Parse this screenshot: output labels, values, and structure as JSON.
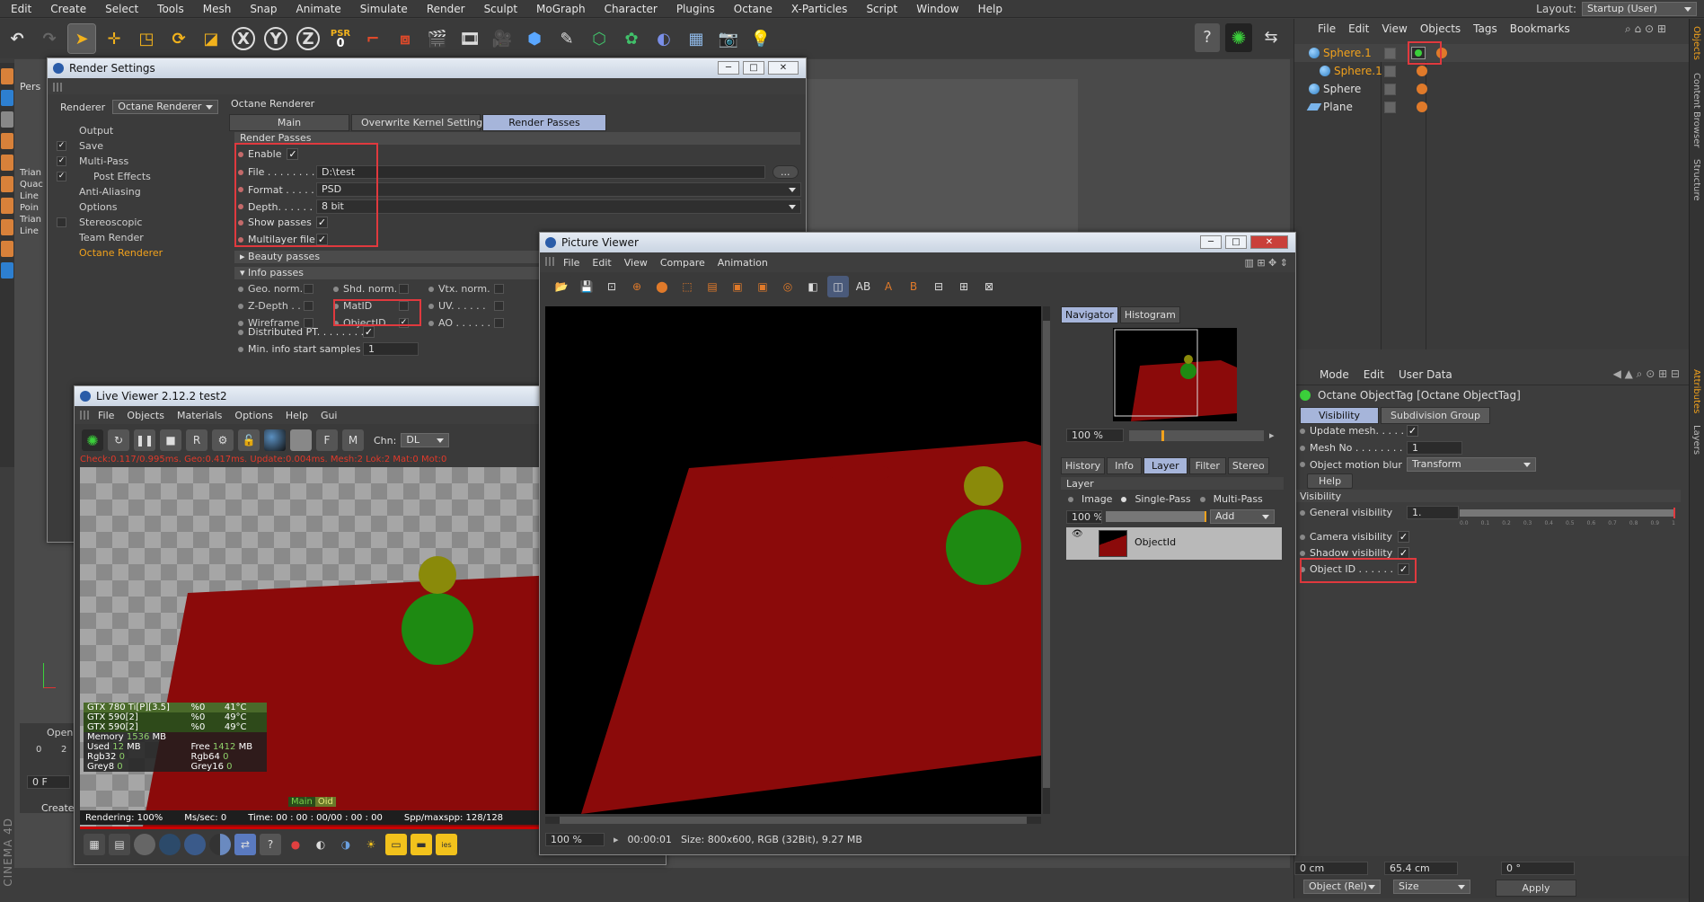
{
  "menubar": {
    "items": [
      "Edit",
      "Create",
      "Select",
      "Tools",
      "Mesh",
      "Snap",
      "Animate",
      "Simulate",
      "Render",
      "Sculpt",
      "MoGraph",
      "Character",
      "Plugins",
      "Octane",
      "X-Particles",
      "Script",
      "Window",
      "Help"
    ],
    "layout_label": "Layout:",
    "layout_value": "Startup (User)"
  },
  "toolbar": {
    "psr_label": "PSR",
    "psr_value": "0",
    "x": "X",
    "y": "Y",
    "z": "Z"
  },
  "viewport": {
    "label": "Pers",
    "stats": [
      "Trian",
      "Quac",
      "Line",
      "Poin",
      "Trian",
      "Line"
    ],
    "timeline_zero": "0",
    "timeline_two": "2",
    "frame_field": "0 F",
    "open_label": "Open",
    "create_label": "Create",
    "brand": "CINEMA 4D"
  },
  "objects": {
    "menu": [
      "File",
      "Edit",
      "View",
      "Objects",
      "Tags",
      "Bookmarks"
    ],
    "rows": [
      {
        "name": "Sphere.1",
        "color": "#f2a21c",
        "icon": "sphere"
      },
      {
        "name": "Sphere.1",
        "color": "#f2a21c",
        "icon": "sphere"
      },
      {
        "name": "Sphere",
        "color": "#e0e0e0",
        "icon": "sphere"
      },
      {
        "name": "Plane",
        "color": "#e0e0e0",
        "icon": "plane"
      }
    ],
    "side_tabs": [
      "Objects",
      "Content Browser",
      "Structure"
    ]
  },
  "attributes": {
    "menu": [
      "Mode",
      "Edit",
      "User Data"
    ],
    "tag_title": "Octane ObjectTag [Octane ObjectTag]",
    "tabs": [
      "Visibility",
      "Subdivision Group"
    ],
    "update_mesh": "Update mesh. . . . .",
    "mesh_no_label": "Mesh No . . . . . . . .",
    "mesh_no_value": "1",
    "motion_blur_label": "Object motion blur",
    "motion_blur_value": "Transform",
    "help": "Help",
    "visibility_section": "Visibility",
    "general_visibility": "General visibility",
    "general_visibility_value": "1.",
    "camera_visibility": "Camera visibility",
    "shadow_visibility": "Shadow visibility",
    "object_id": "Object ID . . . . . .",
    "slider_ticks": [
      "0.0",
      "0.1",
      "0.2",
      "0.3",
      "0.4",
      "0.5",
      "0.6",
      "0.7",
      "0.8",
      "0.9",
      "1"
    ],
    "side_tabs": [
      "Attributes",
      "Layers"
    ],
    "coord_x": "0 cm",
    "coord_y": "65.4 cm",
    "coord_z": "0 °",
    "coord_mode": "Object (Rel)",
    "coord_size": "Size",
    "apply": "Apply"
  },
  "render_settings": {
    "title": "Render Settings",
    "renderer_label": "Renderer",
    "renderer_value": "Octane Renderer",
    "tree": [
      {
        "label": "Output",
        "checked": false,
        "indent": 0
      },
      {
        "label": "Save",
        "checked": true,
        "indent": 0
      },
      {
        "label": "Multi-Pass",
        "checked": true,
        "indent": 0
      },
      {
        "label": "Post Effects",
        "checked": true,
        "indent": 1
      },
      {
        "label": "Anti-Aliasing",
        "checked": false,
        "indent": 0
      },
      {
        "label": "Options",
        "checked": false,
        "indent": 0
      },
      {
        "label": "Stereoscopic",
        "checked": false,
        "indent": 0
      },
      {
        "label": "Team Render",
        "checked": false,
        "indent": 0
      },
      {
        "label": "Octane Renderer",
        "checked": false,
        "indent": 0,
        "active": true
      }
    ],
    "panel_title": "Octane Renderer",
    "tabs": [
      "Main",
      "Overwrite Kernel Settings",
      "Render Passes"
    ],
    "section_render_passes": "Render Passes",
    "enable": "Enable",
    "file_label": "File . . . . . . . . .",
    "file_value": "D:\\test",
    "browse": "...",
    "format_label": "Format . . . . . .",
    "format_value": "PSD",
    "depth_label": "Depth. . . . . . . .",
    "depth_value": "8 bit",
    "show_passes": "Show passes",
    "multilayer": "Multilayer file",
    "beauty": "Beauty passes",
    "info": "Info passes",
    "info_passes": [
      [
        "Geo. norm.",
        "Shd. norm.",
        "Vtx. norm."
      ],
      [
        "Z-Depth . .",
        "MatID",
        "UV. . . . . ."
      ],
      [
        "Wireframe",
        "ObjectID. .",
        "AO . . . . . ."
      ]
    ],
    "distributed": "Distributed PT. . . . . . . .",
    "min_samples_label": "Min. info start samples",
    "min_samples_value": "1"
  },
  "live_viewer": {
    "title": "Live Viewer 2.12.2 test2",
    "menu": [
      "File",
      "Objects",
      "Materials",
      "Options",
      "Help",
      "Gui"
    ],
    "channel_label": "Chn:",
    "channel_value": "DL",
    "status": "Check:0.117/0.995ms. Geo:0.417ms. Update:0.004ms. Mesh:2 Lok:2 Mat:0 Mot:0",
    "gpus": [
      {
        "name": "GTX 780 Ti[P][3.5]",
        "pct": "%0",
        "temp": "41°C"
      },
      {
        "name": "GTX 590[2]",
        "pct": "%0",
        "temp": "49°C"
      },
      {
        "name": "GTX 590[2]",
        "pct": "%0",
        "temp": "49°C"
      }
    ],
    "memory_label": "Memory",
    "memory_value": "1536",
    "mb": "MB",
    "used_label": "Used",
    "used_value": "12",
    "free_label": "Free",
    "free_value": "1412",
    "rgb32": "Rgb32",
    "rgb32_v": "0",
    "rgb64": "Rgb64",
    "rgb64_v": "0",
    "grey8": "Grey8",
    "grey8_v": "0",
    "grey16": "Grey16",
    "grey16_v": "0",
    "main_tag": "Main",
    "oid_tag": "Oid",
    "rendering": "Rendering: 100%",
    "ms_sec": "Ms/sec: 0",
    "time": "Time: 00 : 00 : 00/00 : 00 : 00",
    "spp": "Spp/maxspp: 128/128"
  },
  "picture_viewer": {
    "title": "Picture Viewer",
    "menu": [
      "File",
      "Edit",
      "View",
      "Compare",
      "Animation"
    ],
    "nav_tabs": [
      "Navigator",
      "Histogram"
    ],
    "zoom": "100 %",
    "tabs": [
      "History",
      "Info",
      "Layer",
      "Filter",
      "Stereo"
    ],
    "layer_label": "Layer",
    "mode_image": "Image",
    "mode_single": "Single-Pass",
    "mode_multi": "Multi-Pass",
    "layer_zoom": "100 %",
    "add": "Add",
    "layer_name": "ObjectId",
    "status_zoom": "100 %",
    "status_time": "00:00:01",
    "status_size": "Size: 800x600, RGB (32Bit), 9.27 MB"
  }
}
